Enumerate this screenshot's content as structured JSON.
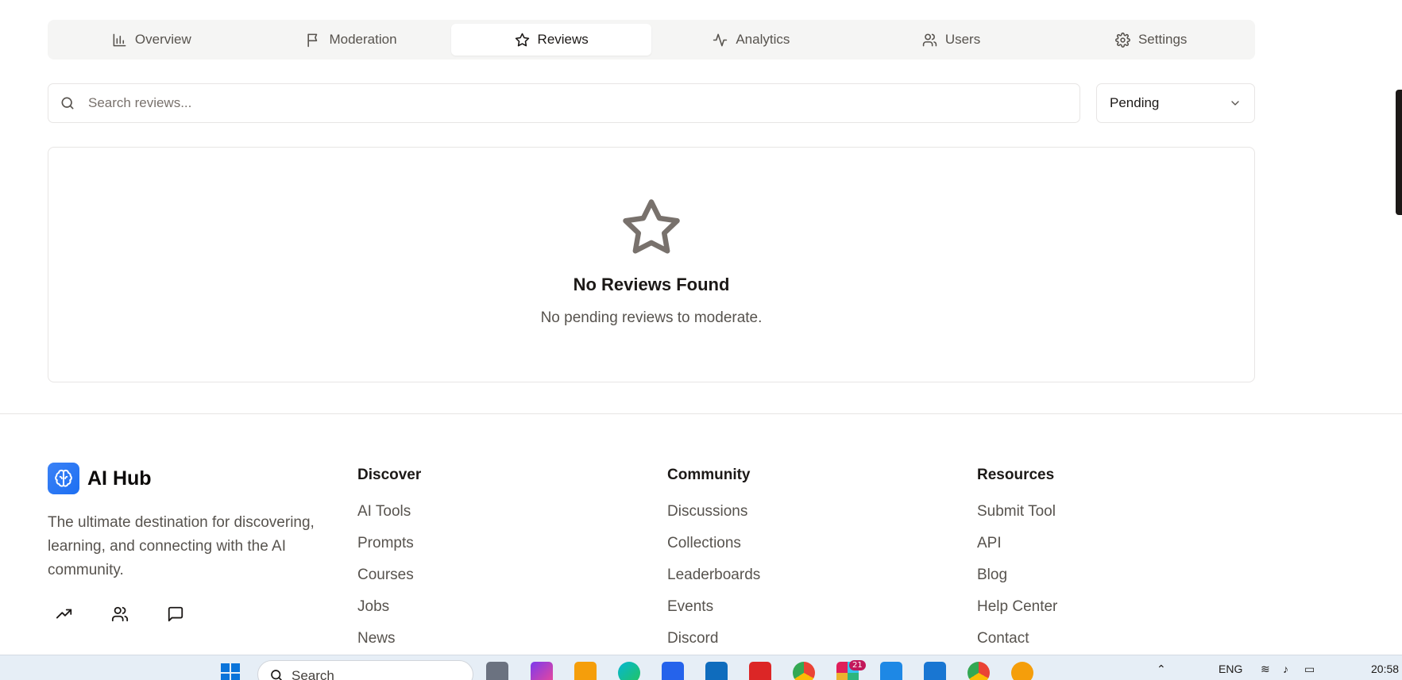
{
  "tabs": [
    {
      "label": "Overview",
      "icon": "bar-chart-icon"
    },
    {
      "label": "Moderation",
      "icon": "flag-icon"
    },
    {
      "label": "Reviews",
      "icon": "star-icon",
      "active": true
    },
    {
      "label": "Analytics",
      "icon": "activity-icon"
    },
    {
      "label": "Users",
      "icon": "users-icon"
    },
    {
      "label": "Settings",
      "icon": "gear-icon"
    }
  ],
  "search": {
    "placeholder": "Search reviews...",
    "value": ""
  },
  "filter": {
    "selected": "Pending"
  },
  "empty_state": {
    "icon": "star-outline-icon",
    "title": "No Reviews Found",
    "message": "No pending reviews to moderate."
  },
  "footer": {
    "brand": "AI Hub",
    "logo_icon": "brain-icon",
    "tagline": "The ultimate destination for discovering, learning, and connecting with the AI community.",
    "social_icons": [
      "trending-up-icon",
      "users-icon",
      "message-icon"
    ],
    "columns": [
      {
        "title": "Discover",
        "links": [
          "AI Tools",
          "Prompts",
          "Courses",
          "Jobs",
          "News"
        ]
      },
      {
        "title": "Community",
        "links": [
          "Discussions",
          "Collections",
          "Leaderboards",
          "Events",
          "Discord"
        ]
      },
      {
        "title": "Resources",
        "links": [
          "Submit Tool",
          "API",
          "Blog",
          "Help Center",
          "Contact"
        ]
      }
    ]
  },
  "taskbar": {
    "search_label": "Search",
    "notification_count": "21",
    "language": "ENG",
    "time": "20:58"
  },
  "colors": {
    "brand": "#2563eb",
    "active_tab_bg": "#ffffff",
    "tab_bar_bg": "#f5f5f4"
  }
}
